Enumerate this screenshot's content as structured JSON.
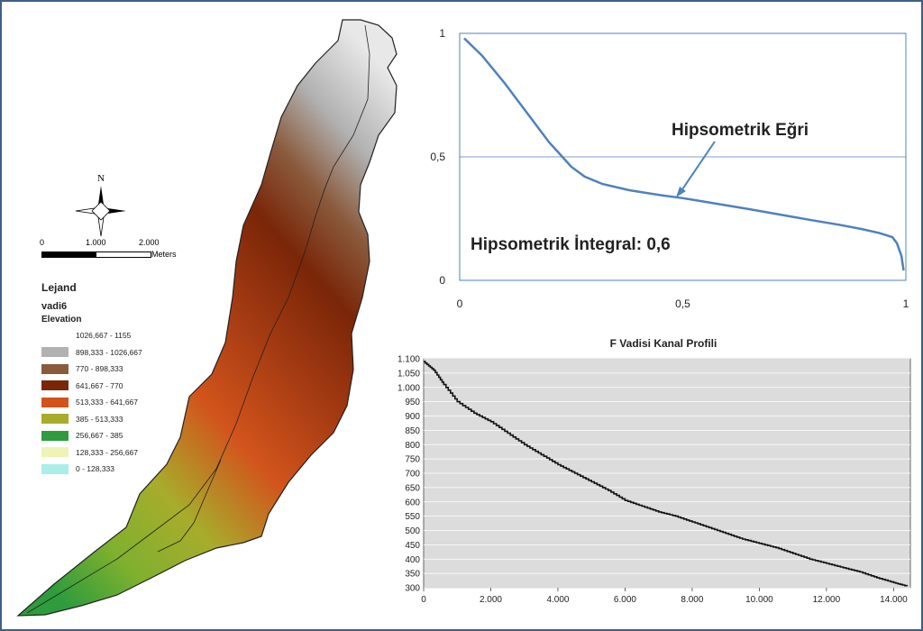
{
  "legend": {
    "title": "Lejand",
    "layer": "vadi6",
    "field": "Elevation",
    "classes": [
      {
        "label": "1026,667 - 1155",
        "color": "#ffffff"
      },
      {
        "label": "898,333 - 1026,667",
        "color": "#b1b1b1"
      },
      {
        "label": "770 - 898,333",
        "color": "#8a5a3c"
      },
      {
        "label": "641,667 - 770",
        "color": "#7a2608"
      },
      {
        "label": "513,333 - 641,667",
        "color": "#d2541c"
      },
      {
        "label": "385 - 513,333",
        "color": "#a8ac2c"
      },
      {
        "label": "256,667 - 385",
        "color": "#2e9c3c"
      },
      {
        "label": "128,333 - 256,667",
        "color": "#eef3b6"
      },
      {
        "label": "0 - 128,333",
        "color": "#a9eee8"
      }
    ]
  },
  "north_arrow": {
    "label": "N",
    "icon": "compass-rose-icon"
  },
  "scale_bar": {
    "ticks": [
      "0",
      "1.000",
      "2.000"
    ],
    "unit": "Meters"
  },
  "hypsometric": {
    "annotation_curve": "Hipsometrik Eğri",
    "annotation_integral": "Hipsometrik İntegral: 0,6",
    "chart_data": {
      "type": "line",
      "x": [
        0.01,
        0.05,
        0.1,
        0.15,
        0.2,
        0.23,
        0.25,
        0.28,
        0.32,
        0.38,
        0.45,
        0.5,
        0.55,
        0.6,
        0.65,
        0.7,
        0.75,
        0.8,
        0.85,
        0.9,
        0.94,
        0.97,
        0.98,
        0.99,
        0.995
      ],
      "y": [
        0.98,
        0.91,
        0.8,
        0.68,
        0.56,
        0.5,
        0.46,
        0.42,
        0.39,
        0.365,
        0.345,
        0.333,
        0.318,
        0.303,
        0.288,
        0.272,
        0.256,
        0.24,
        0.225,
        0.208,
        0.192,
        0.175,
        0.15,
        0.1,
        0.04
      ],
      "xlim": [
        0,
        1
      ],
      "ylim": [
        0,
        1
      ],
      "xticks": [
        "0",
        "0,5",
        "1"
      ],
      "yticks": [
        "0",
        "0,5",
        "1"
      ],
      "color": "#4f81bd"
    }
  },
  "profile": {
    "chart_data": {
      "type": "line",
      "title": "F Vadisi Kanal Profili",
      "x": [
        0,
        300,
        600,
        1000,
        1500,
        2000,
        2500,
        3000,
        3500,
        4000,
        4500,
        5000,
        5500,
        6000,
        6500,
        7000,
        7500,
        8000,
        8500,
        9000,
        9500,
        10000,
        10500,
        11000,
        11500,
        12000,
        12500,
        13000,
        13500,
        14000,
        14400
      ],
      "y": [
        1090,
        1060,
        1010,
        950,
        910,
        880,
        840,
        800,
        765,
        730,
        700,
        670,
        640,
        605,
        585,
        565,
        550,
        530,
        510,
        490,
        470,
        455,
        440,
        420,
        400,
        385,
        370,
        355,
        335,
        318,
        305
      ],
      "xlim": [
        0,
        14500
      ],
      "ylim": [
        300,
        1100
      ],
      "xticks": [
        "0",
        "2.000",
        "4.000",
        "6.000",
        "8.000",
        "10.000",
        "12.000",
        "14.000"
      ],
      "yticks": [
        "1.100",
        "1.050",
        "1.000",
        "950",
        "900",
        "850",
        "800",
        "750",
        "700",
        "650",
        "600",
        "550",
        "500",
        "450",
        "400",
        "350",
        "300"
      ]
    }
  }
}
